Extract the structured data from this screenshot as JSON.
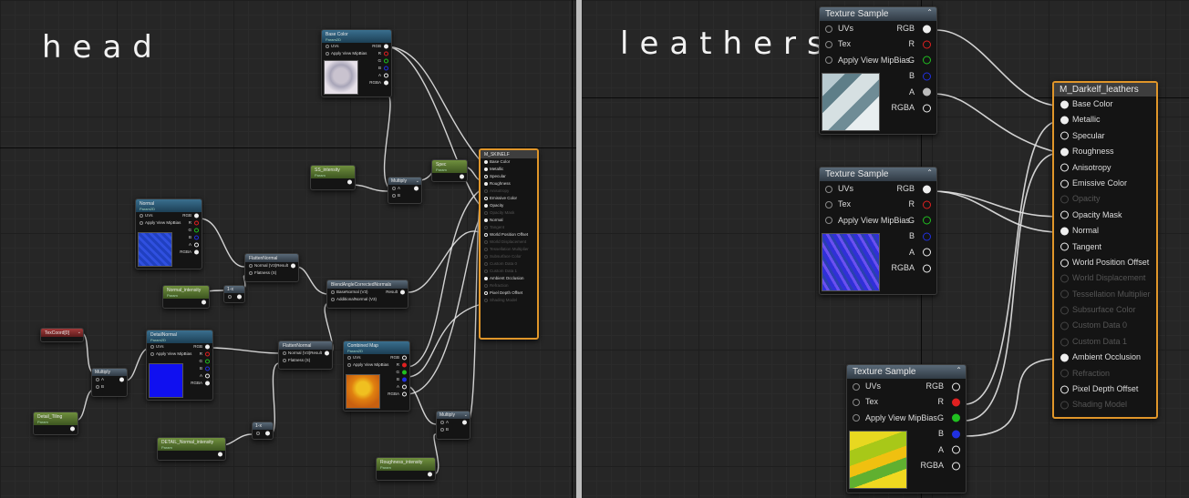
{
  "left_panel": {
    "title": "head",
    "nodes": {
      "base_color": {
        "title": "Base Color",
        "sub": "Param2D",
        "inputs": [
          "UVs",
          "Apply View MipBias"
        ],
        "outputs": [
          "RGB",
          "R",
          "G",
          "B",
          "A",
          "RGBA"
        ]
      },
      "normal": {
        "title": "Normal",
        "sub": "Param2D",
        "inputs": [
          "UVs",
          "Apply View MipBias"
        ],
        "outputs": [
          "RGB",
          "R",
          "G",
          "B",
          "A",
          "RGBA"
        ]
      },
      "detail_normal": {
        "title": "DetailNormal",
        "sub": "Param2D",
        "inputs": [
          "UVs",
          "Apply View MipBias"
        ],
        "outputs": [
          "RGB",
          "R",
          "G",
          "B",
          "A",
          "RGBA"
        ]
      },
      "combined_map": {
        "title": "Combined Map",
        "sub": "Param2D",
        "inputs": [
          "UVs",
          "Apply View MipBias"
        ],
        "outputs": [
          "RGB",
          "R",
          "G",
          "B",
          "A",
          "RGBA"
        ]
      },
      "flatten_normal_1": {
        "title": "FlattenNormal",
        "inputs": [
          "Normal (V3)",
          "Flatness (S)"
        ],
        "output": "Result"
      },
      "flatten_normal_2": {
        "title": "FlattenNormal",
        "inputs": [
          "Normal (V3)",
          "Flatness (S)"
        ],
        "output": "Result"
      },
      "blend_angle": {
        "title": "BlendAngleCorrectedNormals",
        "inputs": [
          "BaseNormal (V3)",
          "AdditionalNormal (V3)"
        ],
        "output": "Result"
      },
      "multiply_top": {
        "title": "Multiply",
        "inputs": [
          "A",
          "B"
        ]
      },
      "multiply_left": {
        "title": "Multiply",
        "inputs": [
          "A",
          "B"
        ]
      },
      "multiply_bottom": {
        "title": "Multiply",
        "inputs": [
          "A",
          "B"
        ]
      },
      "one_minus_1": {
        "title": "1-x"
      },
      "one_minus_2": {
        "title": "1-x"
      },
      "ss_intensity": {
        "title": "SS_intensity",
        "sub": "Param"
      },
      "spec": {
        "title": "Spec",
        "sub": "Param"
      },
      "normal_intensity": {
        "title": "Normal_intensity",
        "sub": "Param"
      },
      "texcoord": {
        "title": "TexCoord[0]"
      },
      "detail_tiling": {
        "title": "Detail_Tiling",
        "sub": "Param"
      },
      "detail_normal_intensity": {
        "title": "DETAIL_Normal_intensity",
        "sub": "Param"
      },
      "roughness_intensity": {
        "title": "Roughness_intensity",
        "sub": "Param"
      },
      "material": {
        "title": "M_SKINELF",
        "inputs": [
          {
            "label": "Base Color",
            "on": true
          },
          {
            "label": "Metallic",
            "on": true
          },
          {
            "label": "Specular",
            "on": true
          },
          {
            "label": "Roughness",
            "on": true
          },
          {
            "label": "Anisotropy",
            "on": false
          },
          {
            "label": "Emissive Color",
            "on": true
          },
          {
            "label": "Opacity",
            "on": true
          },
          {
            "label": "Opacity Mask",
            "on": false
          },
          {
            "label": "Normal",
            "on": true
          },
          {
            "label": "Tangent",
            "on": false
          },
          {
            "label": "World Position Offset",
            "on": true
          },
          {
            "label": "World Displacement",
            "on": false
          },
          {
            "label": "Tessellation Multiplier",
            "on": false
          },
          {
            "label": "Subsurface Color",
            "on": false
          },
          {
            "label": "Custom Data 0",
            "on": false
          },
          {
            "label": "Custom Data 1",
            "on": false
          },
          {
            "label": "Ambient Occlusion",
            "on": true
          },
          {
            "label": "Refraction",
            "on": false
          },
          {
            "label": "Pixel Depth Offset",
            "on": true
          },
          {
            "label": "Shading Model",
            "on": false
          }
        ]
      }
    }
  },
  "right_panel": {
    "title": "leathers",
    "texture_samples": [
      {
        "title": "Texture Sample",
        "inputs": [
          "UVs",
          "Tex",
          "Apply View MipBias"
        ],
        "outputs": [
          "RGB",
          "R",
          "G",
          "B",
          "A",
          "RGBA"
        ],
        "collapse": "⌃"
      },
      {
        "title": "Texture Sample",
        "inputs": [
          "UVs",
          "Tex",
          "Apply View MipBias"
        ],
        "outputs": [
          "RGB",
          "R",
          "G",
          "B",
          "A",
          "RGBA"
        ],
        "collapse": "⌃"
      },
      {
        "title": "Texture Sample",
        "inputs": [
          "UVs",
          "Tex",
          "Apply View MipBias"
        ],
        "outputs": [
          "RGB",
          "R",
          "G",
          "B",
          "A",
          "RGBA"
        ],
        "collapse": "⌃"
      }
    ],
    "material": {
      "title": "M_Darkelf_leathers",
      "inputs": [
        {
          "label": "Base Color",
          "on": true
        },
        {
          "label": "Metallic",
          "on": true
        },
        {
          "label": "Specular",
          "on": true
        },
        {
          "label": "Roughness",
          "on": true
        },
        {
          "label": "Anisotropy",
          "on": true
        },
        {
          "label": "Emissive Color",
          "on": true
        },
        {
          "label": "Opacity",
          "on": false
        },
        {
          "label": "Opacity Mask",
          "on": true
        },
        {
          "label": "Normal",
          "on": true
        },
        {
          "label": "Tangent",
          "on": true
        },
        {
          "label": "World Position Offset",
          "on": true
        },
        {
          "label": "World Displacement",
          "on": false
        },
        {
          "label": "Tessellation Multiplier",
          "on": false
        },
        {
          "label": "Subsurface Color",
          "on": false
        },
        {
          "label": "Custom Data 0",
          "on": false
        },
        {
          "label": "Custom Data 1",
          "on": false
        },
        {
          "label": "Ambient Occlusion",
          "on": true
        },
        {
          "label": "Refraction",
          "on": false
        },
        {
          "label": "Pixel Depth Offset",
          "on": true
        },
        {
          "label": "Shading Model",
          "on": false
        }
      ]
    }
  },
  "colors": {
    "param_blue": "#2a5a78",
    "param_green": "#5a7a2e",
    "texcoord_red": "#8e2e2e",
    "material_border": "#e0962a",
    "pin_red": "#e02020",
    "pin_green": "#20c020",
    "pin_blue": "#2030e0"
  }
}
